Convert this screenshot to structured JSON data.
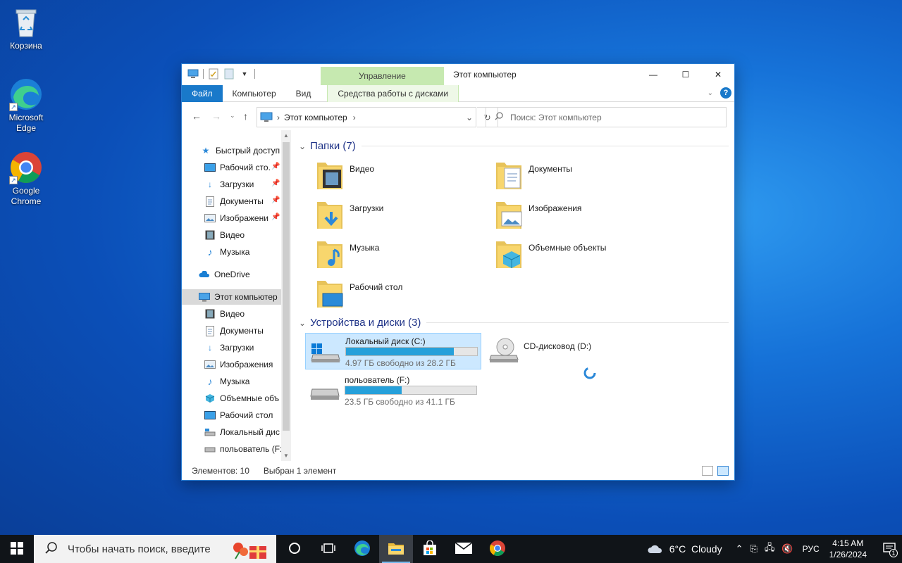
{
  "desktop": {
    "icons": [
      {
        "label": "Корзина",
        "icon": "recycle-bin-icon"
      },
      {
        "label": "Microsoft Edge",
        "icon": "edge-icon"
      },
      {
        "label": "Google Chrome",
        "icon": "chrome-icon"
      }
    ]
  },
  "window": {
    "title": "Этот компьютер",
    "context_tab_group": "Управление",
    "controls": {
      "minimize": "—",
      "maximize": "☐",
      "close": "✕"
    },
    "ribbon_tabs": [
      "Файл",
      "Компьютер",
      "Вид",
      "Средства работы с дисками"
    ],
    "address": {
      "location": "Этот компьютер"
    },
    "search": {
      "placeholder": "Поиск: Этот компьютер"
    },
    "nav_pane": {
      "quick_access": "Быстрый доступ",
      "quick_items": [
        "Рабочий сто.",
        "Загрузки",
        "Документы",
        "Изображени",
        "Видео",
        "Музыка"
      ],
      "onedrive": "OneDrive",
      "this_pc": "Этот компьютер",
      "pc_items": [
        "Видео",
        "Документы",
        "Загрузки",
        "Изображения",
        "Музыка",
        "Объемные объ",
        "Рабочий стол",
        "Локальный дис",
        "польователь (F:"
      ]
    },
    "folders_header": "Папки (7)",
    "folders": [
      "Видео",
      "Документы",
      "Загрузки",
      "Изображения",
      "Музыка",
      "Объемные объекты",
      "Рабочий стол"
    ],
    "devices_header": "Устройства и диски (3)",
    "drives": [
      {
        "name": "Локальный диск (C:)",
        "free": "4.97 ГБ свободно из 28.2 ГБ",
        "used_fraction": 0.82,
        "selected": true
      },
      {
        "name": "CD-дисковод (D:)",
        "free": "",
        "used_fraction": null,
        "selected": false
      },
      {
        "name": "польователь (F:)",
        "free": "23.5 ГБ свободно из 41.1 ГБ",
        "used_fraction": 0.43,
        "selected": false
      }
    ],
    "status": {
      "count": "Элементов: 10",
      "selection": "Выбран 1 элемент"
    }
  },
  "taskbar": {
    "search_placeholder": "Чтобы начать поиск, введите",
    "weather": "6°C  Cloudy",
    "lang": "РУС",
    "time": "4:15 AM",
    "date": "1/26/2024",
    "notifications": "1"
  },
  "colors": {
    "accent": "#1979ca",
    "selection": "#cce8ff",
    "drive_bar": "#26a0da",
    "context_tab": "#c6e9b0"
  }
}
